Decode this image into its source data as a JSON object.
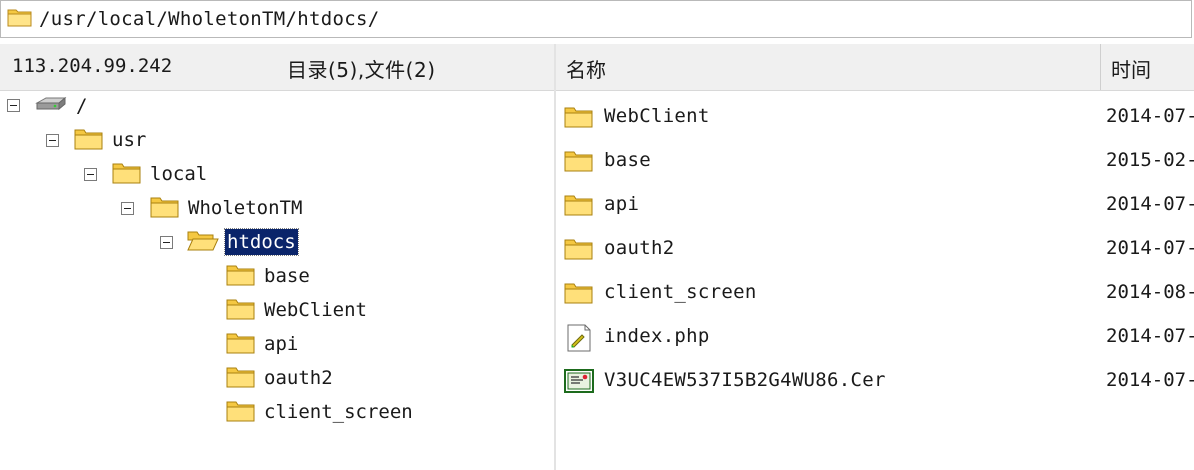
{
  "path_bar": {
    "path": "/usr/local/WholetonTM/htdocs/"
  },
  "left_header": {
    "host": "113.204.99.242",
    "counts": "目录(5),文件(2)"
  },
  "right_header": {
    "col_name": "名称",
    "col_time": "时间"
  },
  "tree": [
    {
      "label": "/"
    },
    {
      "label": "usr"
    },
    {
      "label": "local"
    },
    {
      "label": "WholetonTM"
    },
    {
      "label": "htdocs",
      "selected": true
    },
    {
      "label": "base"
    },
    {
      "label": "WebClient"
    },
    {
      "label": "api"
    },
    {
      "label": "oauth2"
    },
    {
      "label": "client_screen"
    }
  ],
  "files": [
    {
      "name": "WebClient",
      "time": "2014-07-",
      "icon": "folder-icon"
    },
    {
      "name": "base",
      "time": "2015-02-",
      "icon": "folder-icon"
    },
    {
      "name": "api",
      "time": "2014-07-",
      "icon": "folder-icon"
    },
    {
      "name": "oauth2",
      "time": "2014-07-",
      "icon": "folder-icon"
    },
    {
      "name": "client_screen",
      "time": "2014-08-",
      "icon": "folder-icon"
    },
    {
      "name": "index.php",
      "time": "2014-07-",
      "icon": "php-file-icon"
    },
    {
      "name": "V3UC4EW537I5B2G4WU86.Cer",
      "time": "2014-07-",
      "icon": "certificate-file-icon"
    }
  ],
  "colors": {
    "selection": "#0a246a",
    "header_bg": "#f0f0f0",
    "folder": "#f5c842"
  }
}
